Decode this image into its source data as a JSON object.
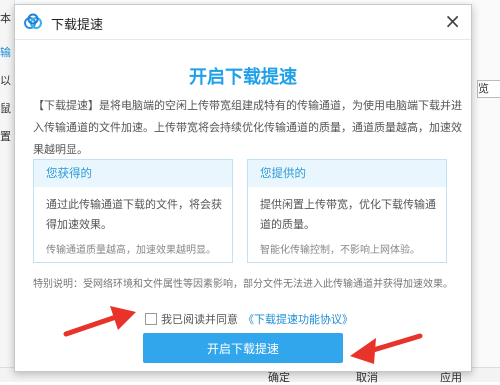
{
  "background": {
    "left_glyphs": [
      "本",
      "输",
      "以",
      "鼠",
      "置"
    ],
    "right_box_text": "览",
    "bottom_buttons": [
      "确定",
      "取消",
      "应用"
    ]
  },
  "dialog": {
    "logo_icon": "cloud-logo-icon",
    "title": "下载提速",
    "close_label": "×",
    "headline": "开启下载提速",
    "intro": "【下载提速】是将电脑端的空闲上传带宽组建成特有的传输通道，为使用电脑端下载并进入传输通道的文件加速。上传带宽将会持续优化传输通道的质量，通道质量越高，加速效果越明显。",
    "cards": [
      {
        "heading": "您获得的",
        "body": "通过此传输通道下载的文件，将会获得加速效果。",
        "note": "传输通道质量越高，加速效果越明显。"
      },
      {
        "heading": "您提供的",
        "body": "提供闲置上传带宽，优化下载传输通道的质量。",
        "note": "智能化传输控制，不影响上网体验。"
      }
    ],
    "special_note": "特别说明：受网络环境和文件属性等因素影响，部分文件无法进入此传输通道并获得加速效果。",
    "agree_prefix": "我已阅读并同意",
    "agree_link": "《下载提速功能协议》",
    "agree_checked": false,
    "primary_button": "开启下载提速"
  },
  "colors": {
    "accent": "#1fa0e8",
    "button": "#31a6ec",
    "arrow": "#e8332a"
  }
}
